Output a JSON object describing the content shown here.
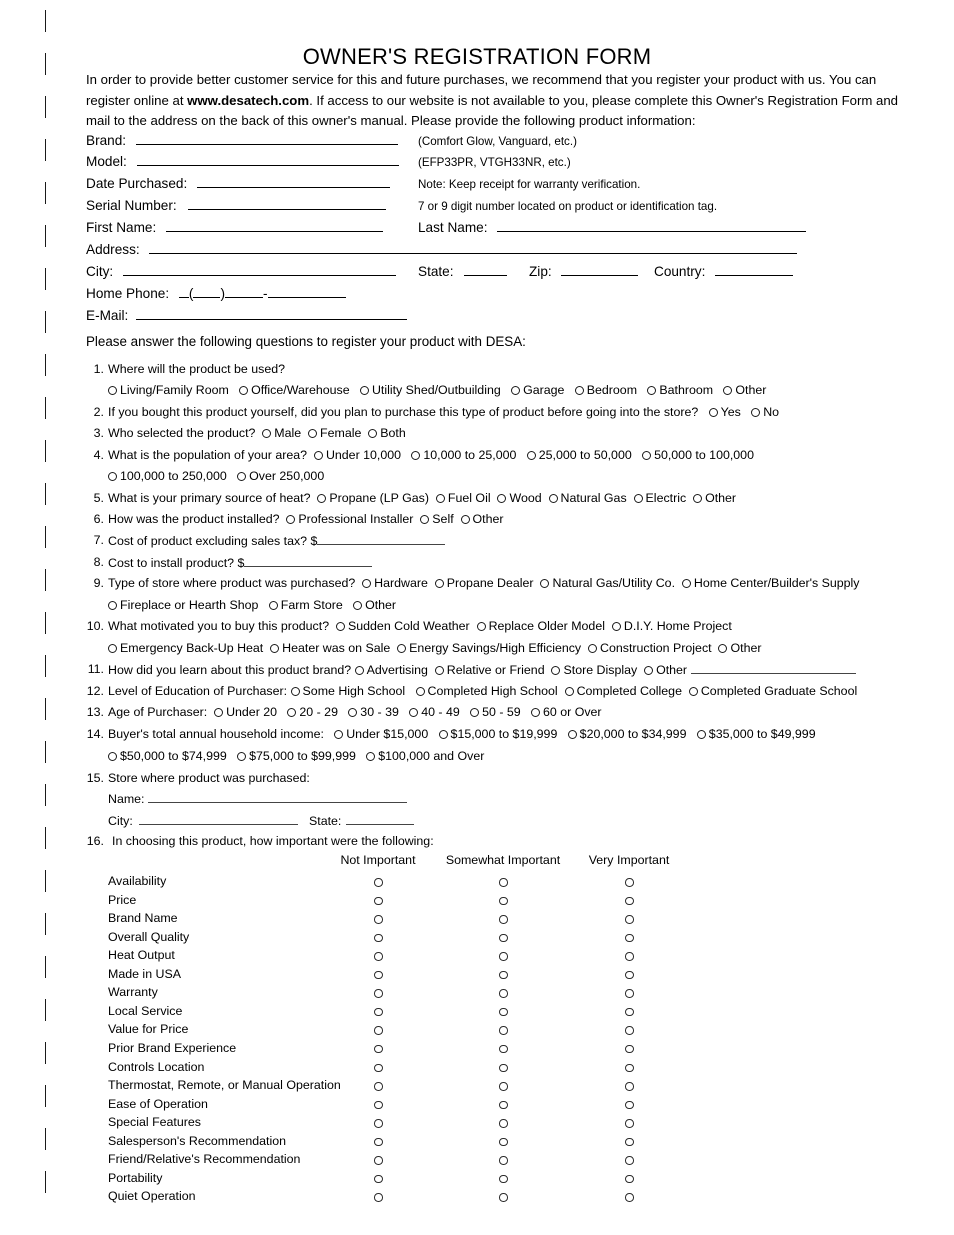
{
  "document": {
    "title": "OWNER'S REGISTRATION FORM",
    "intro_lines": [
      "In order to provide better customer service for this and future purchases, we recommend that you register your product with us.",
      "You can register online at ",
      ". If access to our website is not available to you, please complete this Owner's",
      "Registration Form and mail to the address on the back of this owner's manual. Please provide the following product information:"
    ],
    "website": "www.desatech.com",
    "questions_intro": "Please answer the following questions to register your product with DESA:"
  },
  "product_fields": [
    {
      "label": "Brand:",
      "hint": "(Comfort Glow, Vanguard, etc.)"
    },
    {
      "label": "Model:",
      "hint": "(EFP33PR, VTGH33NR, etc.)"
    },
    {
      "label": "Date Purchased:",
      "hint": "Note: Keep receipt for warranty verification."
    },
    {
      "label": "Serial Number:",
      "hint": "7 or 9 digit number located on product or identification tag."
    }
  ],
  "name_fields": {
    "first_name": "First Name:",
    "last_name": "Last Name:",
    "address": "Address:",
    "city": "City:",
    "state": "State:",
    "zip": "Zip:",
    "country": "Country:",
    "home_phone": "Home Phone:",
    "phone_open_paren": "(",
    "phone_close_paren": ")",
    "phone_dash": "-",
    "email": "E-Mail:"
  },
  "questions": [
    {
      "num": "1.",
      "text": "Where will the product be used?",
      "option_rows": [
        [
          "Living/Family Room",
          "Office/Warehouse",
          "Utility Shed/Outbuilding",
          "Garage",
          "Bedroom",
          "Bathroom",
          "Other"
        ]
      ]
    },
    {
      "num": "2.",
      "text": "If you bought this product yourself, did you plan to purchase this type of product before going into the store?",
      "inline_options": [
        "Yes",
        "No"
      ]
    },
    {
      "num": "3.",
      "text": "Who selected the product?",
      "inline_options": [
        "Male",
        "Female",
        "Both"
      ]
    },
    {
      "num": "4.",
      "text": "What is the population of your area?",
      "inline_options": [
        "Under 10,000",
        "10,000 to 25,000",
        "25,000 to 50,000",
        "50,000 to 100,000"
      ],
      "option_rows": [
        [
          "100,000 to 250,000",
          "Over 250,000"
        ]
      ]
    },
    {
      "num": "5.",
      "text": "What is your primary source of heat?",
      "inline_options": [
        "Propane (LP Gas)",
        "Fuel Oil",
        "Wood",
        "Natural Gas",
        "Electric",
        "Other"
      ]
    },
    {
      "num": "6.",
      "text": "How was the product installed?",
      "inline_options": [
        "Professional Installer",
        "Self",
        "Other"
      ]
    },
    {
      "num": "7.",
      "text": "Cost of product excluding sales tax? $",
      "has_blank": true
    },
    {
      "num": "8.",
      "text": "Cost to install product? $",
      "has_blank": true
    },
    {
      "num": "9.",
      "text": "Type of store where product was purchased?",
      "inline_options": [
        "Hardware",
        "Propane Dealer",
        "Natural Gas/Utility Co.",
        "Home Center/Builder's Supply"
      ],
      "option_rows": [
        [
          "Fireplace or Hearth Shop",
          "Farm Store",
          "Other"
        ]
      ]
    },
    {
      "num": "10.",
      "text": "What motivated you to buy this product?",
      "inline_options": [
        "Sudden Cold Weather",
        "Replace Older Model",
        "D.I.Y. Home Project"
      ],
      "option_rows": [
        [
          "Emergency Back-Up Heat",
          "Heater was on Sale",
          "Energy Savings/High Efficiency",
          "Construction Project",
          "Other"
        ]
      ]
    },
    {
      "num": "11.",
      "text": "How did you learn about this product brand?",
      "inline_options": [
        "Advertising",
        "Relative or Friend",
        "Store Display",
        "Other"
      ],
      "trailing_blank": true
    },
    {
      "num": "12.",
      "text": "Level of Education of Purchaser:",
      "inline_options": [
        "Some High School",
        "Completed High School",
        "Completed College",
        "Completed Graduate School"
      ]
    },
    {
      "num": "13.",
      "text": "Age of Purchaser:",
      "inline_options": [
        "Under 20",
        "20 - 29",
        "30 - 39",
        "40 - 49",
        "50 - 59",
        "60 or Over"
      ]
    },
    {
      "num": "14.",
      "text": "Buyer's total annual household income:",
      "inline_options": [
        "Under $15,000",
        "$15,000 to $19,999",
        "$20,000 to $34,999",
        "$35,000 to $49,999"
      ],
      "option_rows": [
        [
          "$50,000 to $74,999",
          "$75,000 to $99,999",
          "$100,000 and Over"
        ]
      ]
    },
    {
      "num": "15.",
      "text": "Store where product was purchased:",
      "subfields": [
        "Name:",
        "City:",
        "State:"
      ]
    },
    {
      "num": "16.",
      "text": "In choosing this product, how important were the following:"
    }
  ],
  "matrix": {
    "columns": [
      "Not Important",
      "Somewhat Important",
      "Very Important"
    ],
    "rows": [
      "Availability",
      "Price",
      "Brand Name",
      "Overall Quality",
      "Heat Output",
      "Made in USA",
      "Warranty",
      "Local Service",
      "Value for Price",
      "Prior Brand Experience",
      "Controls Location",
      "Thermostat, Remote, or Manual Operation",
      "Ease of Operation",
      "Special Features",
      "Salesperson's Recommendation",
      "Friend/Relative's Recommendation",
      "Portability",
      "Quiet Operation"
    ]
  }
}
